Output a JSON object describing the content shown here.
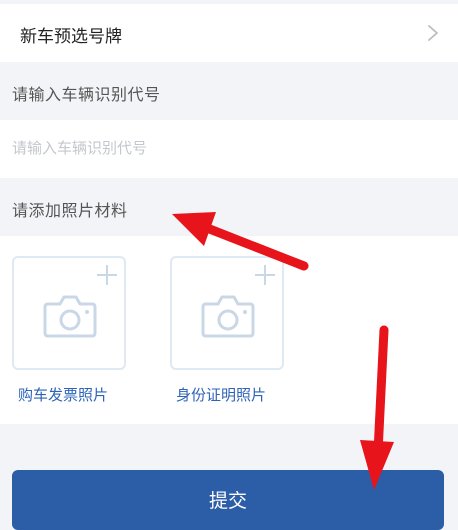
{
  "plate": {
    "label": "新车预选号牌",
    "chevron_icon": "chevron-right-icon"
  },
  "vin": {
    "section_label": "请输入车辆识别代号",
    "placeholder": "请输入车辆识别代号",
    "value": ""
  },
  "photos": {
    "section_label": "请添加照片材料",
    "items": [
      {
        "caption": "购车发票照片",
        "icon": "camera-icon",
        "add_icon": "plus-icon"
      },
      {
        "caption": "身份证明照片",
        "icon": "camera-icon",
        "add_icon": "plus-icon"
      }
    ]
  },
  "submit": {
    "label": "提交"
  },
  "colors": {
    "background": "#f3f4f7",
    "accent_blue": "#2c5ea8",
    "caption_blue": "#2e63b8",
    "annotation_red": "#e8141b"
  }
}
